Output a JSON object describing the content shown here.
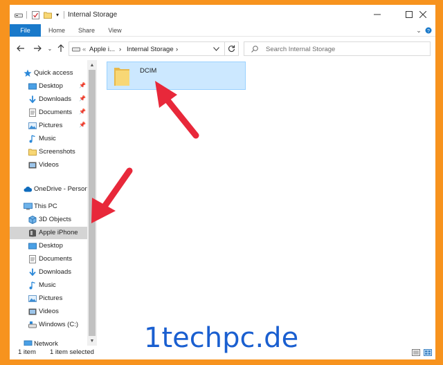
{
  "window": {
    "title": "Internal Storage"
  },
  "ribbon": {
    "tabs": [
      {
        "label": "File"
      },
      {
        "label": "Home"
      },
      {
        "label": "Share"
      },
      {
        "label": "View"
      }
    ]
  },
  "address": {
    "crumbs": [
      "Apple i...",
      "Internal Storage"
    ],
    "search_placeholder": "Search Internal Storage"
  },
  "nav": {
    "quick_access": "Quick access",
    "quick_items": [
      {
        "label": "Desktop",
        "icon": "desktop-icon",
        "pinned": true
      },
      {
        "label": "Downloads",
        "icon": "download-icon",
        "pinned": true
      },
      {
        "label": "Documents",
        "icon": "document-icon",
        "pinned": true
      },
      {
        "label": "Pictures",
        "icon": "picture-icon",
        "pinned": true
      },
      {
        "label": "Music",
        "icon": "music-icon",
        "pinned": false
      },
      {
        "label": "Screenshots",
        "icon": "folder-icon",
        "pinned": false
      },
      {
        "label": "Videos",
        "icon": "video-icon",
        "pinned": false
      }
    ],
    "onedrive": "OneDrive - Person",
    "this_pc": "This PC",
    "pc_items": [
      {
        "label": "3D Objects",
        "icon": "cube-icon"
      },
      {
        "label": "Apple iPhone",
        "icon": "phone-icon"
      },
      {
        "label": "Desktop",
        "icon": "desktop-icon"
      },
      {
        "label": "Documents",
        "icon": "document-icon"
      },
      {
        "label": "Downloads",
        "icon": "download-icon"
      },
      {
        "label": "Music",
        "icon": "music-icon"
      },
      {
        "label": "Pictures",
        "icon": "picture-icon"
      },
      {
        "label": "Videos",
        "icon": "video-icon"
      },
      {
        "label": "Windows (C:)",
        "icon": "drive-icon"
      }
    ],
    "network": "Network",
    "selected": "Apple iPhone"
  },
  "content": {
    "items": [
      {
        "name": "DCIM",
        "icon": "folder-icon"
      }
    ]
  },
  "status": {
    "count": "1 item",
    "selection": "1 item selected"
  },
  "watermark": "1techpc.de",
  "colors": {
    "frame": "#f7931e",
    "accent": "#1979ca",
    "selection": "#cce8ff",
    "arrow": "#e8283a",
    "watermark": "#1a5fd0"
  }
}
